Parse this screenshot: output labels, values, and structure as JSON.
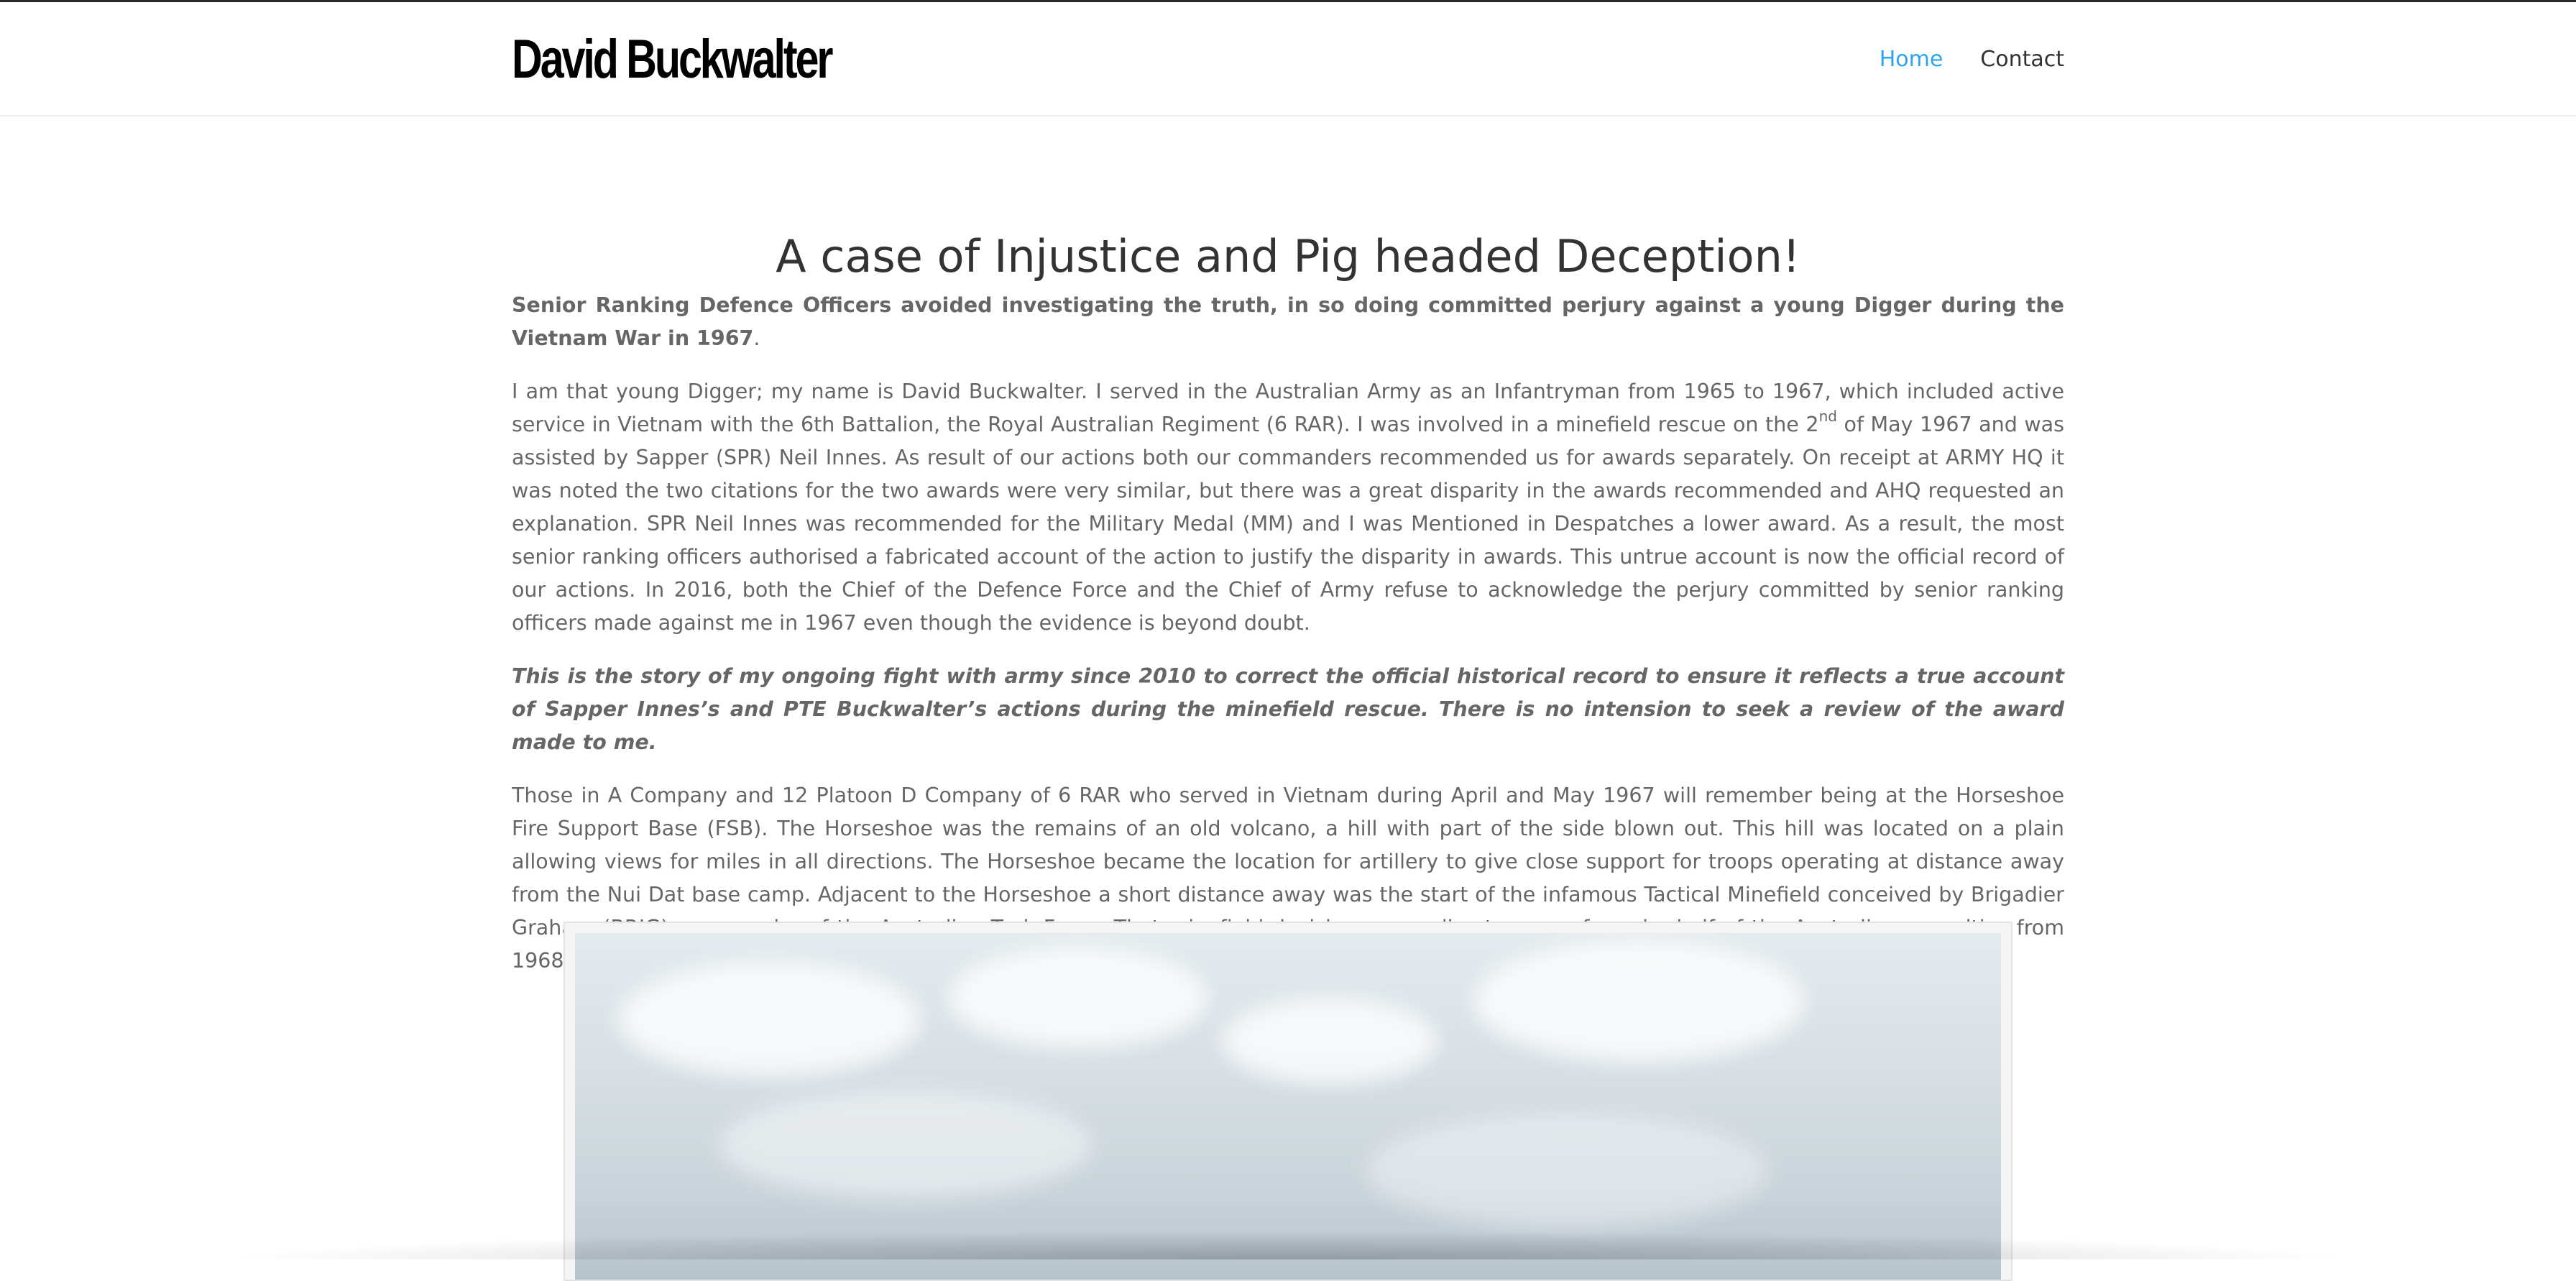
{
  "header": {
    "logo_text": "David Buckwalter",
    "nav": [
      {
        "label": "Home",
        "active": true
      },
      {
        "label": "Contact",
        "active": false
      }
    ],
    "accent_color": "#2ea3f2"
  },
  "page": {
    "title": "A case of Injustice and Pig headed Deception!",
    "lead": "Senior Ranking Defence Officers avoided investigating the truth, in so doing committed perjury against a young Digger during the Vietnam War in 1967",
    "lead_end": ".",
    "p1_part1": "I am that young Digger; my name is David Buckwalter. I served in the Australian Army as an Infantryman from 1965 to 1967, which included active service in Vietnam with the 6th Battalion, the Royal Australian Regiment (6 RAR). I was involved in a minefield rescue on the 2",
    "p1_sup": "nd",
    "p1_part2": " of May 1967 and was assisted by Sapper (SPR) Neil Innes. As result of our actions both our commanders recommended us for awards separately. On receipt at ARMY HQ it was noted the two citations for the two awards were very similar, but there was a great disparity in the awards recommended and AHQ requested an explanation. SPR Neil Innes was recommended for the Military Medal (MM) and I was Mentioned in Despatches a lower award. As a result, the most senior ranking officers authorised a fabricated account of the action to justify the disparity in awards. This untrue account is now the official record of our actions. In 2016, both the Chief of the Defence Force and the Chief of Army refuse to acknowledge the perjury committed by senior ranking officers made against me in 1967 even though the evidence is beyond doubt.",
    "p2": "This is the story of my ongoing fight with army since 2010 to correct the official historical record to ensure it reflects a true account of Sapper Innes’s and PTE Buckwalter’s actions during the minefield rescue. There is no intension to seek a review of the award made to me.",
    "p3": "Those in A Company and 12 Platoon D Company of 6 RAR who served in Vietnam during April and May 1967 will remember being at the Horseshoe Fire Support Base (FSB). The Horseshoe was the remains of an old volcano, a hill with part of the side blown out. This hill was located on a plain allowing views for miles in all directions. The Horseshoe became the location for artillery to give close support for troops operating at distance away from the Nui Dat base camp. Adjacent to the Horseshoe a short distance away was the start of the infamous Tactical Minefield conceived by Brigadier Graham (BRIG) commander of the Australian Task Force. That minefield decision was a direct cause of maybe half of the Australian casualties from 1968 onwards."
  }
}
